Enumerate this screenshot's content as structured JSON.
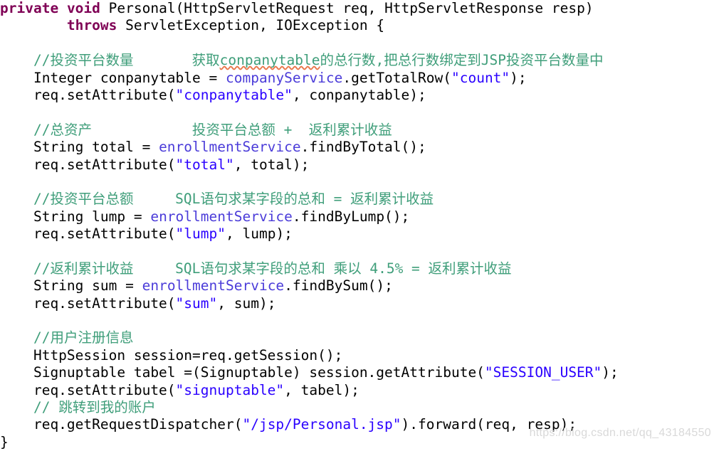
{
  "editor": {
    "language": "java",
    "background_color": "#ffffff",
    "colors": {
      "keyword": "#7f0055",
      "comment": "#3f9e7a",
      "string": "#2a00ff",
      "field": "#4b3cd9",
      "plain": "#000000",
      "spellcheck_underline": "#e8774a"
    }
  },
  "watermark": {
    "text": "https://blog.csdn.net/qq_43184550"
  },
  "code": {
    "lines": [
      {
        "id": "line-1",
        "tokens": [
          {
            "t": "kw",
            "v": "private"
          },
          {
            "t": "plain",
            "v": " "
          },
          {
            "t": "kw",
            "v": "void"
          },
          {
            "t": "plain",
            "v": " Personal(HttpServletRequest req, HttpServletResponse resp)"
          }
        ]
      },
      {
        "id": "line-2",
        "tokens": [
          {
            "t": "plain",
            "v": "        "
          },
          {
            "t": "kw",
            "v": "throws"
          },
          {
            "t": "plain",
            "v": " ServletException, IOException {"
          }
        ]
      },
      {
        "id": "line-3",
        "tokens": []
      },
      {
        "id": "line-4",
        "tokens": [
          {
            "t": "plain",
            "v": "    "
          },
          {
            "t": "cmt",
            "v": "//投资平台数量       获取"
          },
          {
            "t": "cmt squig",
            "v": "conpanytable"
          },
          {
            "t": "cmt",
            "v": "的总行数,把总行数绑定到JSP投资平台数量中"
          }
        ]
      },
      {
        "id": "line-5",
        "tokens": [
          {
            "t": "plain",
            "v": "    Integer conpanytable = "
          },
          {
            "t": "fld",
            "v": "companyService"
          },
          {
            "t": "plain",
            "v": ".getTotalRow("
          },
          {
            "t": "str",
            "v": "\"count\""
          },
          {
            "t": "plain",
            "v": ");"
          }
        ]
      },
      {
        "id": "line-6",
        "tokens": [
          {
            "t": "plain",
            "v": "    req.setAttribute("
          },
          {
            "t": "str",
            "v": "\"conpanytable\""
          },
          {
            "t": "plain",
            "v": ", conpanytable);"
          }
        ]
      },
      {
        "id": "line-7",
        "tokens": []
      },
      {
        "id": "line-8",
        "tokens": [
          {
            "t": "plain",
            "v": "    "
          },
          {
            "t": "cmt",
            "v": "//总资产            投资平台总额 +  返利累计收益"
          }
        ]
      },
      {
        "id": "line-9",
        "tokens": [
          {
            "t": "plain",
            "v": "    String total = "
          },
          {
            "t": "fld",
            "v": "enrollmentService"
          },
          {
            "t": "plain",
            "v": ".findByTotal();"
          }
        ]
      },
      {
        "id": "line-10",
        "tokens": [
          {
            "t": "plain",
            "v": "    req.setAttribute("
          },
          {
            "t": "str",
            "v": "\"total\""
          },
          {
            "t": "plain",
            "v": ", total);"
          }
        ]
      },
      {
        "id": "line-11",
        "tokens": []
      },
      {
        "id": "line-12",
        "tokens": [
          {
            "t": "plain",
            "v": "    "
          },
          {
            "t": "cmt",
            "v": "//投资平台总额     SQL语句求某字段的总和 = 返利累计收益"
          }
        ]
      },
      {
        "id": "line-13",
        "tokens": [
          {
            "t": "plain",
            "v": "    String lump = "
          },
          {
            "t": "fld",
            "v": "enrollmentService"
          },
          {
            "t": "plain",
            "v": ".findByLump();"
          }
        ]
      },
      {
        "id": "line-14",
        "tokens": [
          {
            "t": "plain",
            "v": "    req.setAttribute("
          },
          {
            "t": "str",
            "v": "\"lump\""
          },
          {
            "t": "plain",
            "v": ", lump);"
          }
        ]
      },
      {
        "id": "line-15",
        "tokens": []
      },
      {
        "id": "line-16",
        "tokens": [
          {
            "t": "plain",
            "v": "    "
          },
          {
            "t": "cmt",
            "v": "//返利累计收益     SQL语句求某字段的总和 乘以 4.5% = 返利累计收益"
          }
        ]
      },
      {
        "id": "line-17",
        "tokens": [
          {
            "t": "plain",
            "v": "    String sum = "
          },
          {
            "t": "fld",
            "v": "enrollmentService"
          },
          {
            "t": "plain",
            "v": ".findBySum();"
          }
        ]
      },
      {
        "id": "line-18",
        "tokens": [
          {
            "t": "plain",
            "v": "    req.setAttribute("
          },
          {
            "t": "str",
            "v": "\"sum\""
          },
          {
            "t": "plain",
            "v": ", sum);"
          }
        ]
      },
      {
        "id": "line-19",
        "tokens": []
      },
      {
        "id": "line-20",
        "tokens": [
          {
            "t": "plain",
            "v": "    "
          },
          {
            "t": "cmt",
            "v": "//用户注册信息"
          }
        ]
      },
      {
        "id": "line-21",
        "tokens": [
          {
            "t": "plain",
            "v": "    HttpSession session=req.getSession();"
          }
        ]
      },
      {
        "id": "line-22",
        "tokens": [
          {
            "t": "plain",
            "v": "    Signuptable tabel =(Signuptable) session.getAttribute("
          },
          {
            "t": "str",
            "v": "\"SESSION_USER\""
          },
          {
            "t": "plain",
            "v": ");"
          }
        ]
      },
      {
        "id": "line-23",
        "tokens": [
          {
            "t": "plain",
            "v": "    req.setAttribute("
          },
          {
            "t": "str",
            "v": "\"signuptable\""
          },
          {
            "t": "plain",
            "v": ", tabel);"
          }
        ]
      },
      {
        "id": "line-24",
        "tokens": [
          {
            "t": "plain",
            "v": "    "
          },
          {
            "t": "cmt",
            "v": "// 跳转到我的账户"
          }
        ]
      },
      {
        "id": "line-25",
        "tokens": [
          {
            "t": "plain",
            "v": "    req.getRequestDispatcher("
          },
          {
            "t": "str",
            "v": "\"/jsp/Personal.jsp\""
          },
          {
            "t": "plain",
            "v": ").forward(req, resp);"
          }
        ]
      },
      {
        "id": "line-26",
        "tokens": [
          {
            "t": "plain",
            "v": "}"
          }
        ]
      }
    ]
  }
}
